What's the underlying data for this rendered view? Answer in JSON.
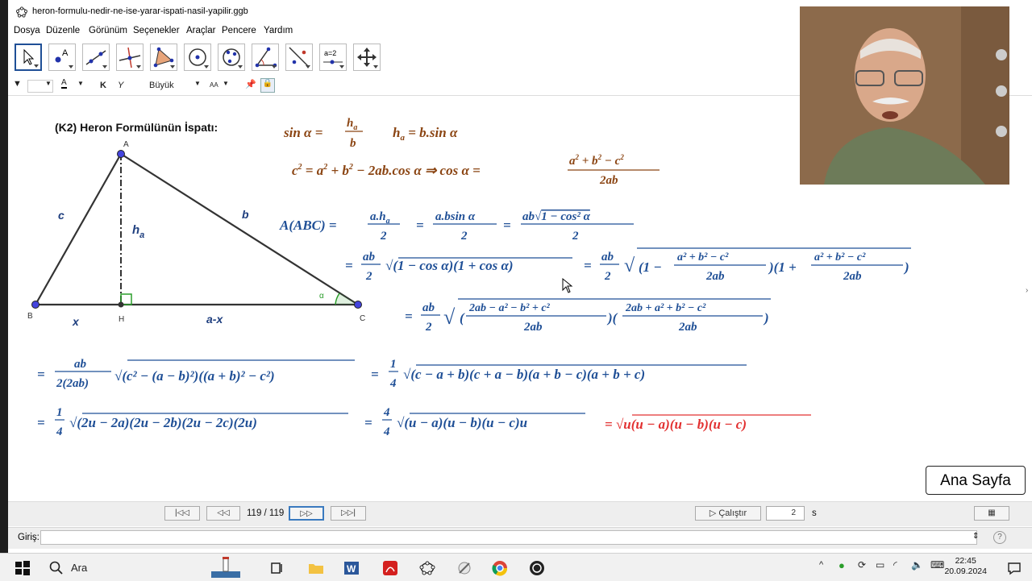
{
  "window": {
    "title": "heron-formulu-nedir-ne-ise-yarar-ispati-nasil-yapilir.ggb"
  },
  "menu": [
    "Dosya",
    "Düzenle",
    "Görünüm",
    "Seçenekler",
    "Araçlar",
    "Pencere",
    "Yardım"
  ],
  "toolbar": {
    "tools": [
      "move-tool",
      "point-tool",
      "line-tool",
      "perpendicular-line-tool",
      "polygon-tool",
      "circle-center-point-tool",
      "circle-three-points-tool",
      "angle-tool",
      "reflect-tool",
      "slider-tool",
      "move-graphics-view-tool"
    ],
    "slider_label": "a=2"
  },
  "stylebar": {
    "bold": "K",
    "italic": "Y",
    "size": "Büyük",
    "aa": "AA"
  },
  "triangle": {
    "labels": {
      "A": "A",
      "B": "B",
      "C": "C",
      "H": "H",
      "c": "c",
      "b": "b",
      "ha_main": "h",
      "ha_sub": "a",
      "x": "x",
      "ax": "a-x",
      "alpha": "α"
    }
  },
  "proof_title": "(K2)  Heron Formülünün İspatı:",
  "navigation": {
    "page": "119 / 119",
    "play_label": "Çalıştır",
    "speed": "2",
    "speed_unit": "s"
  },
  "input_bar": {
    "label": "Giriş:",
    "value": ""
  },
  "home_button": "Ana Sayfa",
  "taskbar": {
    "search_placeholder": "Ara",
    "time": "22:45",
    "date": "20.09.2024"
  },
  "colors": {
    "formula_brown": "#8b4513",
    "formula_blue": "#1f4f96",
    "formula_red": "#e23030",
    "selection": "#1f4f96"
  }
}
